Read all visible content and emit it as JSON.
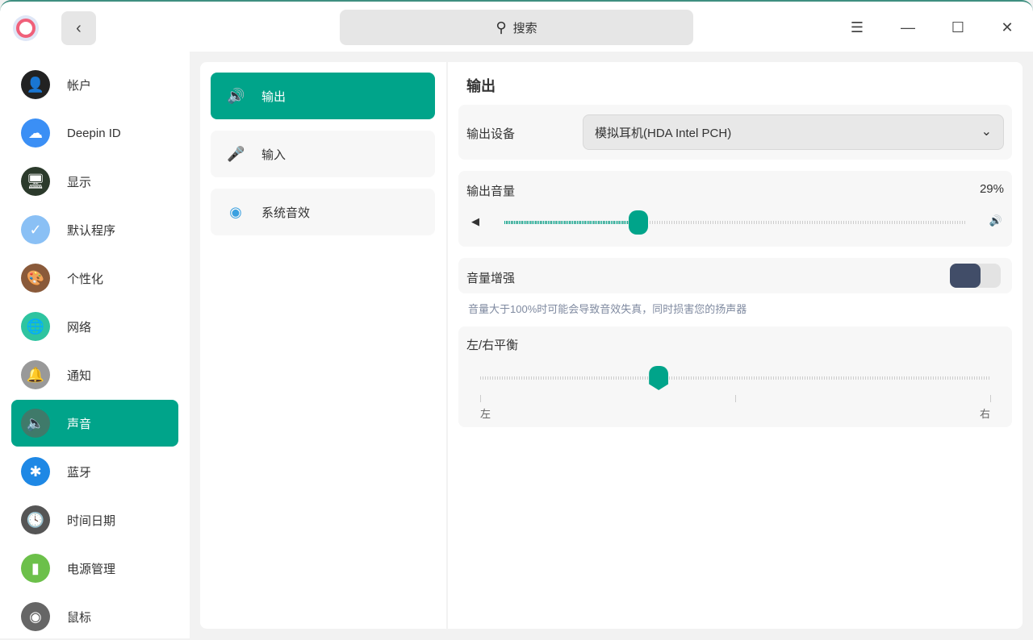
{
  "titlebar": {
    "search_placeholder": "搜索"
  },
  "sidebar": {
    "items": [
      {
        "label": "帐户",
        "icon": "account-icon",
        "color": "#222"
      },
      {
        "label": "Deepin ID",
        "icon": "cloud-icon",
        "color": "#3b8ff5"
      },
      {
        "label": "显示",
        "icon": "display-icon",
        "color": "#2b3a2b"
      },
      {
        "label": "默认程序",
        "icon": "default-apps-icon",
        "color": "#8ac0f5"
      },
      {
        "label": "个性化",
        "icon": "personalization-icon",
        "color": "#8a5a3a"
      },
      {
        "label": "网络",
        "icon": "network-icon",
        "color": "#2ec4a0"
      },
      {
        "label": "通知",
        "icon": "bell-icon",
        "color": "#999"
      },
      {
        "label": "声音",
        "icon": "speaker-icon",
        "color": "#3f7a6a"
      },
      {
        "label": "蓝牙",
        "icon": "bluetooth-icon",
        "color": "#1e88e5"
      },
      {
        "label": "时间日期",
        "icon": "clock-icon",
        "color": "#555"
      },
      {
        "label": "电源管理",
        "icon": "battery-icon",
        "color": "#6cc04a"
      },
      {
        "label": "鼠标",
        "icon": "mouse-icon",
        "color": "#666"
      }
    ],
    "active": 7
  },
  "middle": {
    "items": [
      {
        "label": "输出",
        "icon": "speaker-output-icon"
      },
      {
        "label": "输入",
        "icon": "microphone-icon"
      },
      {
        "label": "系统音效",
        "icon": "system-sound-icon"
      }
    ]
  },
  "output": {
    "title": "输出",
    "device_label": "输出设备",
    "device_value": "模拟耳机(HDA Intel PCH)",
    "volume_label": "输出音量",
    "volume_text": "29%",
    "volume_fraction": 0.29,
    "boost_label": "音量增强",
    "boost_on": false,
    "boost_hint": "音量大于100%时可能会导致音效失真，同时损害您的扬声器",
    "balance_label": "左/右平衡",
    "balance_fraction": 0.35,
    "left_label": "左",
    "right_label": "右"
  },
  "colors": {
    "accent": "#00a48a",
    "toggle_knob": "#414d68"
  }
}
